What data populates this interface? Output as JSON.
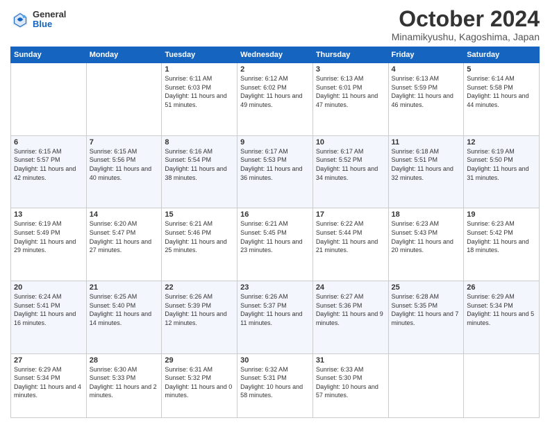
{
  "header": {
    "logo": {
      "general": "General",
      "blue": "Blue"
    },
    "title": "October 2024",
    "subtitle": "Minamikyushu, Kagoshima, Japan"
  },
  "calendar": {
    "days_of_week": [
      "Sunday",
      "Monday",
      "Tuesday",
      "Wednesday",
      "Thursday",
      "Friday",
      "Saturday"
    ],
    "weeks": [
      {
        "days": [
          {
            "num": "",
            "info": ""
          },
          {
            "num": "",
            "info": ""
          },
          {
            "num": "1",
            "info": "Sunrise: 6:11 AM\nSunset: 6:03 PM\nDaylight: 11 hours and 51 minutes."
          },
          {
            "num": "2",
            "info": "Sunrise: 6:12 AM\nSunset: 6:02 PM\nDaylight: 11 hours and 49 minutes."
          },
          {
            "num": "3",
            "info": "Sunrise: 6:13 AM\nSunset: 6:01 PM\nDaylight: 11 hours and 47 minutes."
          },
          {
            "num": "4",
            "info": "Sunrise: 6:13 AM\nSunset: 5:59 PM\nDaylight: 11 hours and 46 minutes."
          },
          {
            "num": "5",
            "info": "Sunrise: 6:14 AM\nSunset: 5:58 PM\nDaylight: 11 hours and 44 minutes."
          }
        ]
      },
      {
        "days": [
          {
            "num": "6",
            "info": "Sunrise: 6:15 AM\nSunset: 5:57 PM\nDaylight: 11 hours and 42 minutes."
          },
          {
            "num": "7",
            "info": "Sunrise: 6:15 AM\nSunset: 5:56 PM\nDaylight: 11 hours and 40 minutes."
          },
          {
            "num": "8",
            "info": "Sunrise: 6:16 AM\nSunset: 5:54 PM\nDaylight: 11 hours and 38 minutes."
          },
          {
            "num": "9",
            "info": "Sunrise: 6:17 AM\nSunset: 5:53 PM\nDaylight: 11 hours and 36 minutes."
          },
          {
            "num": "10",
            "info": "Sunrise: 6:17 AM\nSunset: 5:52 PM\nDaylight: 11 hours and 34 minutes."
          },
          {
            "num": "11",
            "info": "Sunrise: 6:18 AM\nSunset: 5:51 PM\nDaylight: 11 hours and 32 minutes."
          },
          {
            "num": "12",
            "info": "Sunrise: 6:19 AM\nSunset: 5:50 PM\nDaylight: 11 hours and 31 minutes."
          }
        ]
      },
      {
        "days": [
          {
            "num": "13",
            "info": "Sunrise: 6:19 AM\nSunset: 5:49 PM\nDaylight: 11 hours and 29 minutes."
          },
          {
            "num": "14",
            "info": "Sunrise: 6:20 AM\nSunset: 5:47 PM\nDaylight: 11 hours and 27 minutes."
          },
          {
            "num": "15",
            "info": "Sunrise: 6:21 AM\nSunset: 5:46 PM\nDaylight: 11 hours and 25 minutes."
          },
          {
            "num": "16",
            "info": "Sunrise: 6:21 AM\nSunset: 5:45 PM\nDaylight: 11 hours and 23 minutes."
          },
          {
            "num": "17",
            "info": "Sunrise: 6:22 AM\nSunset: 5:44 PM\nDaylight: 11 hours and 21 minutes."
          },
          {
            "num": "18",
            "info": "Sunrise: 6:23 AM\nSunset: 5:43 PM\nDaylight: 11 hours and 20 minutes."
          },
          {
            "num": "19",
            "info": "Sunrise: 6:23 AM\nSunset: 5:42 PM\nDaylight: 11 hours and 18 minutes."
          }
        ]
      },
      {
        "days": [
          {
            "num": "20",
            "info": "Sunrise: 6:24 AM\nSunset: 5:41 PM\nDaylight: 11 hours and 16 minutes."
          },
          {
            "num": "21",
            "info": "Sunrise: 6:25 AM\nSunset: 5:40 PM\nDaylight: 11 hours and 14 minutes."
          },
          {
            "num": "22",
            "info": "Sunrise: 6:26 AM\nSunset: 5:39 PM\nDaylight: 11 hours and 12 minutes."
          },
          {
            "num": "23",
            "info": "Sunrise: 6:26 AM\nSunset: 5:37 PM\nDaylight: 11 hours and 11 minutes."
          },
          {
            "num": "24",
            "info": "Sunrise: 6:27 AM\nSunset: 5:36 PM\nDaylight: 11 hours and 9 minutes."
          },
          {
            "num": "25",
            "info": "Sunrise: 6:28 AM\nSunset: 5:35 PM\nDaylight: 11 hours and 7 minutes."
          },
          {
            "num": "26",
            "info": "Sunrise: 6:29 AM\nSunset: 5:34 PM\nDaylight: 11 hours and 5 minutes."
          }
        ]
      },
      {
        "days": [
          {
            "num": "27",
            "info": "Sunrise: 6:29 AM\nSunset: 5:34 PM\nDaylight: 11 hours and 4 minutes."
          },
          {
            "num": "28",
            "info": "Sunrise: 6:30 AM\nSunset: 5:33 PM\nDaylight: 11 hours and 2 minutes."
          },
          {
            "num": "29",
            "info": "Sunrise: 6:31 AM\nSunset: 5:32 PM\nDaylight: 11 hours and 0 minutes."
          },
          {
            "num": "30",
            "info": "Sunrise: 6:32 AM\nSunset: 5:31 PM\nDaylight: 10 hours and 58 minutes."
          },
          {
            "num": "31",
            "info": "Sunrise: 6:33 AM\nSunset: 5:30 PM\nDaylight: 10 hours and 57 minutes."
          },
          {
            "num": "",
            "info": ""
          },
          {
            "num": "",
            "info": ""
          }
        ]
      }
    ]
  }
}
